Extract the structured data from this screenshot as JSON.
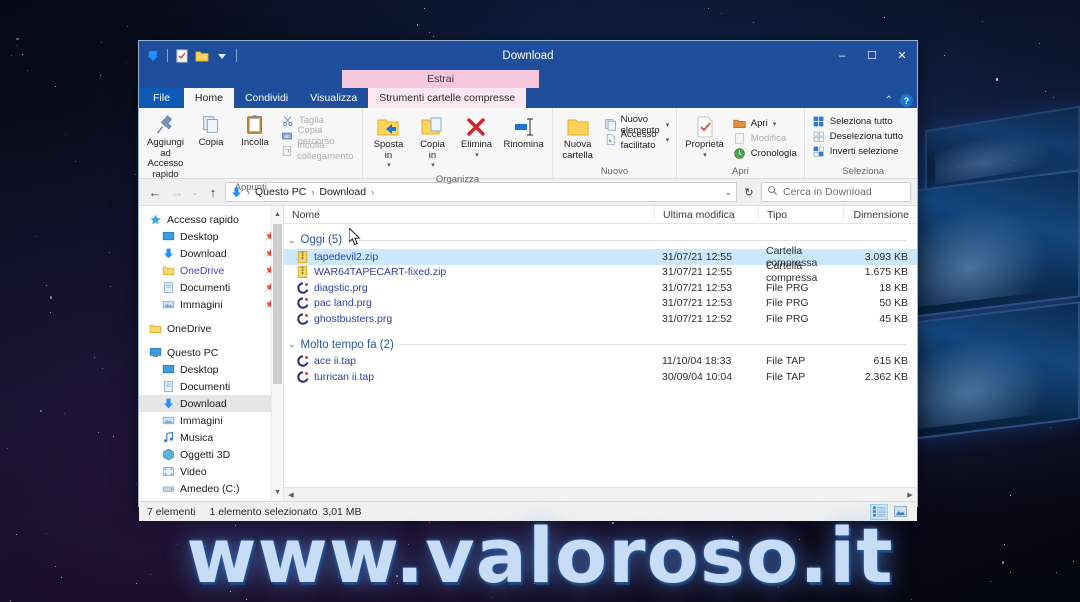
{
  "window": {
    "title": "Download",
    "quick_access_icons": [
      "download-arrow-icon",
      "properties-icon",
      "new-folder-icon",
      "customize-dropdown-icon"
    ],
    "minimize_label": "–",
    "maximize_label": "☐",
    "close_label": "✕",
    "ribbon_collapse_label": "⌃",
    "help_label": "?"
  },
  "contextual": {
    "band_label": "Estrai",
    "tab_label": "Strumenti cartelle compresse"
  },
  "tabs": [
    {
      "label": "File",
      "kind": "file"
    },
    {
      "label": "Home",
      "kind": "active"
    },
    {
      "label": "Condividi",
      "kind": "normal"
    },
    {
      "label": "Visualizza",
      "kind": "normal"
    }
  ],
  "ribbon": {
    "groups": [
      {
        "name": "Appunti",
        "big": [
          {
            "label": "Aggiungi ad\nAccesso rapido",
            "icon": "pin-icon",
            "dim": false
          },
          {
            "label": "Copia",
            "icon": "copy-icon",
            "dim": false
          },
          {
            "label": "Incolla",
            "icon": "paste-icon",
            "dim": false
          }
        ],
        "small": [
          {
            "label": "Taglia",
            "icon": "scissors-icon",
            "dim": true,
            "caret": false
          },
          {
            "label": "Copia percorso",
            "icon": "copy-path-icon",
            "dim": true,
            "caret": false
          },
          {
            "label": "Incolla collegamento",
            "icon": "paste-shortcut-icon",
            "dim": true,
            "caret": false
          }
        ]
      },
      {
        "name": "Organizza",
        "big": [
          {
            "label": "Sposta\nin",
            "icon": "move-to-icon",
            "dim": false,
            "caret": true
          },
          {
            "label": "Copia\nin",
            "icon": "copy-to-icon",
            "dim": false,
            "caret": true
          },
          {
            "label": "Elimina",
            "icon": "delete-x-icon",
            "dim": false,
            "caret": true
          },
          {
            "label": "Rinomina",
            "icon": "rename-icon",
            "dim": false,
            "caret": false
          }
        ],
        "small": []
      },
      {
        "name": "Nuovo",
        "big": [
          {
            "label": "Nuova\ncartella",
            "icon": "new-folder-icon",
            "dim": false
          }
        ],
        "small": [
          {
            "label": "Nuovo elemento",
            "icon": "new-item-icon",
            "dim": false,
            "caret": true
          },
          {
            "label": "Accesso facilitato",
            "icon": "easy-access-icon",
            "dim": false,
            "caret": true
          }
        ]
      },
      {
        "name": "Apri",
        "big": [
          {
            "label": "Proprietà",
            "icon": "properties-icon",
            "dim": false,
            "caret": true
          }
        ],
        "small": [
          {
            "label": "Apri",
            "icon": "open-icon",
            "dim": false,
            "caret": true
          },
          {
            "label": "Modifica",
            "icon": "edit-icon",
            "dim": true,
            "caret": false
          },
          {
            "label": "Cronologia",
            "icon": "history-icon",
            "dim": false,
            "caret": false
          }
        ]
      },
      {
        "name": "Seleziona",
        "big": [],
        "small": [
          {
            "label": "Seleziona tutto",
            "icon": "select-all-icon",
            "dim": false,
            "caret": false
          },
          {
            "label": "Deseleziona tutto",
            "icon": "deselect-all-icon",
            "dim": false,
            "caret": false
          },
          {
            "label": "Inverti selezione",
            "icon": "invert-selection-icon",
            "dim": false,
            "caret": false
          }
        ]
      }
    ]
  },
  "address": {
    "back_label": "←",
    "forward_label": "→",
    "recent_label": "⌄",
    "up_label": "↑",
    "icon": "download-arrow-icon",
    "crumbs": [
      "Questo PC",
      "Download"
    ],
    "crumb_separator": "›",
    "dropdown_label": "⌄",
    "refresh_label": "↻",
    "search_placeholder": "Cerca in Download",
    "search_value": "",
    "search_icon": "search-icon"
  },
  "nav": {
    "items": [
      {
        "label": "Accesso rapido",
        "icon": "star-icon",
        "level": 0,
        "pinned": false,
        "selected": false
      },
      {
        "label": "Desktop",
        "icon": "desktop-icon",
        "level": 1,
        "pinned": true,
        "selected": false
      },
      {
        "label": "Download",
        "icon": "download-arrow-icon",
        "level": 1,
        "pinned": true,
        "selected": false
      },
      {
        "label": "OneDrive",
        "icon": "onedrive-folder-icon",
        "level": 1,
        "pinned": true,
        "selected": false
      },
      {
        "label": "Documenti",
        "icon": "documents-icon",
        "level": 1,
        "pinned": true,
        "selected": false
      },
      {
        "label": "Immagini",
        "icon": "pictures-icon",
        "level": 1,
        "pinned": true,
        "selected": false
      },
      {
        "label": "__GAP__",
        "icon": "",
        "level": 0,
        "pinned": false,
        "selected": false
      },
      {
        "label": "OneDrive",
        "icon": "folder-icon",
        "level": 0,
        "pinned": false,
        "selected": false
      },
      {
        "label": "__GAP__",
        "icon": "",
        "level": 0,
        "pinned": false,
        "selected": false
      },
      {
        "label": "Questo PC",
        "icon": "pc-icon",
        "level": 0,
        "pinned": false,
        "selected": false
      },
      {
        "label": "Desktop",
        "icon": "desktop-icon",
        "level": 1,
        "pinned": false,
        "selected": false
      },
      {
        "label": "Documenti",
        "icon": "documents-icon",
        "level": 1,
        "pinned": false,
        "selected": false
      },
      {
        "label": "Download",
        "icon": "download-arrow-icon",
        "level": 1,
        "pinned": false,
        "selected": true
      },
      {
        "label": "Immagini",
        "icon": "pictures-icon",
        "level": 1,
        "pinned": false,
        "selected": false
      },
      {
        "label": "Musica",
        "icon": "music-icon",
        "level": 1,
        "pinned": false,
        "selected": false
      },
      {
        "label": "Oggetti 3D",
        "icon": "objects3d-icon",
        "level": 1,
        "pinned": false,
        "selected": false
      },
      {
        "label": "Video",
        "icon": "video-icon",
        "level": 1,
        "pinned": false,
        "selected": false
      },
      {
        "label": "Amedeo (C:)",
        "icon": "drive-icon",
        "level": 1,
        "pinned": false,
        "selected": false
      }
    ]
  },
  "columns": [
    {
      "label": "Nome",
      "key": "name"
    },
    {
      "label": "Ultima modifica",
      "key": "date"
    },
    {
      "label": "Tipo",
      "key": "type"
    },
    {
      "label": "Dimensione",
      "key": "size"
    }
  ],
  "groups": [
    {
      "label": "Oggi (5)",
      "chevron": "⌄",
      "files": [
        {
          "name": "tapedevil2.zip",
          "date": "31/07/21 12:55",
          "type": "Cartella compressa",
          "size": "3.093 KB",
          "icon": "zip-icon",
          "selected": true
        },
        {
          "name": "WAR64TAPECART-fixed.zip",
          "date": "31/07/21 12:55",
          "type": "Cartella compressa",
          "size": "1.675 KB",
          "icon": "zip-icon",
          "selected": false
        },
        {
          "name": "diagstic.prg",
          "date": "31/07/21 12:53",
          "type": "File PRG",
          "size": "18 KB",
          "icon": "prg-icon",
          "selected": false
        },
        {
          "name": "pac land.prg",
          "date": "31/07/21 12:53",
          "type": "File PRG",
          "size": "50 KB",
          "icon": "prg-icon",
          "selected": false
        },
        {
          "name": "ghostbusters.prg",
          "date": "31/07/21 12:52",
          "type": "File PRG",
          "size": "45 KB",
          "icon": "prg-icon",
          "selected": false
        }
      ]
    },
    {
      "label": "Molto tempo fa (2)",
      "chevron": "⌄",
      "files": [
        {
          "name": "ace ii.tap",
          "date": "11/10/04 18:33",
          "type": "File TAP",
          "size": "615 KB",
          "icon": "tap-icon",
          "selected": false
        },
        {
          "name": "turrican ii.tap",
          "date": "30/09/04 10:04",
          "type": "File TAP",
          "size": "2.362 KB",
          "icon": "tap-icon",
          "selected": false
        }
      ]
    }
  ],
  "status": {
    "item_count": "7 elementi",
    "selection": "1 elemento selezionato",
    "selection_size": "3,01 MB",
    "view_details_icon": "details-view-icon",
    "view_large_icon": "large-icons-view-icon"
  },
  "watermark": {
    "text": "www.valoroso.it"
  },
  "colors": {
    "titlebar": "#1f4e9c",
    "contextual_band": "#f7c8dc",
    "selection": "#cce8ff",
    "group_header": "#2b5797",
    "link_text": "#2b3ea8"
  }
}
